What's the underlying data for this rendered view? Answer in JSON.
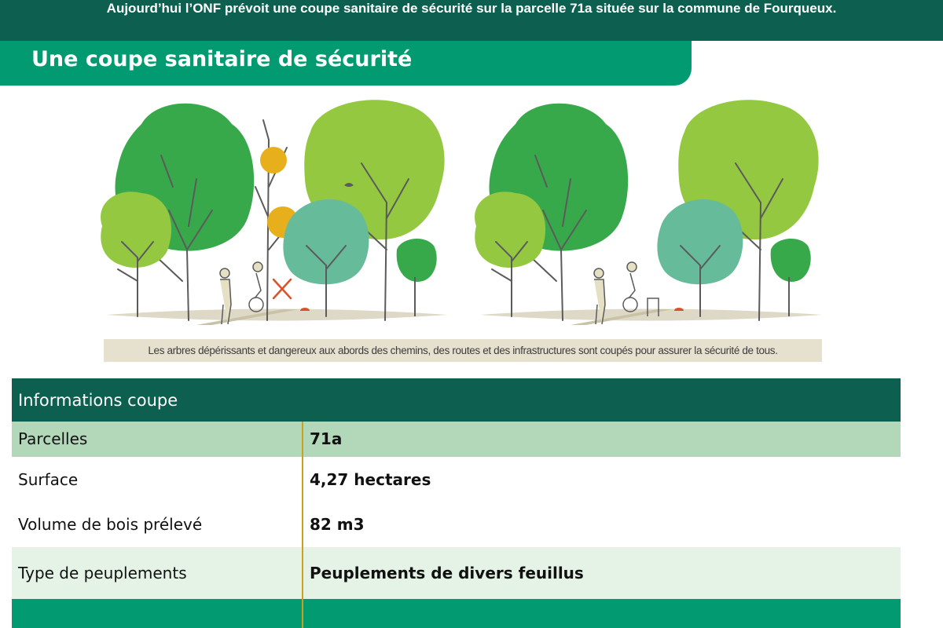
{
  "banner": {
    "text": "Aujourd’hui l’ONF prévoit une coupe sanitaire de sécurité sur la parcelle 71a située sur la commune de Fourqueux."
  },
  "section": {
    "title": "Une coupe sanitaire de sécurité"
  },
  "illustration": {
    "caption": "Les arbres dépérissants et dangereux aux abords des chemins, des routes et des infrastructures sont coupés pour assurer la sécurité de tous.",
    "icons": [
      "cross-mark-icon",
      "bird-icon",
      "mushroom-icon",
      "walker-icon",
      "cyclist-icon"
    ]
  },
  "info": {
    "header": "Informations coupe",
    "rows": [
      {
        "label": "Parcelles",
        "value": "71a"
      },
      {
        "label": "Surface",
        "value": "4,27 hectares"
      },
      {
        "label": "Volume de bois prélevé",
        "value": "82 m3"
      },
      {
        "label": "Type de peuplements",
        "value": "Peuplements de divers feuillus"
      }
    ]
  },
  "colors": {
    "dark_green": "#0d5f50",
    "title_green": "#029a70",
    "row_highlight": "#b2d8b9",
    "row_light": "#e5f2e6",
    "divider_gold": "#c9a11c",
    "caption_bg": "#e6e0cf"
  }
}
